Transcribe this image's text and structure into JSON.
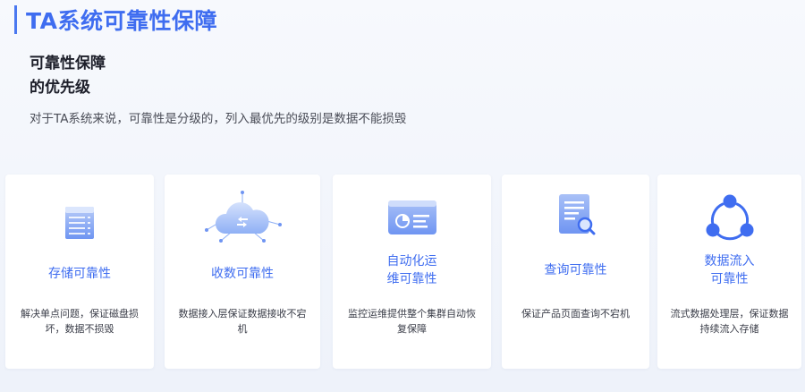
{
  "header": {
    "title": "TA系统可靠性保障"
  },
  "section": {
    "heading_line1": "可靠性保障",
    "heading_line2": "的优先级",
    "description": "对于TA系统来说，可靠性是分级的，列入最优先的级别是数据不能损毁"
  },
  "cards": [
    {
      "icon": "server-storage-icon",
      "title": "存储可靠性",
      "text": "解决单点问题，保证磁盘损坏，数据不损毁"
    },
    {
      "icon": "cloud-network-icon",
      "title": "收数可靠性",
      "text": "数据接入层保证数据接收不宕机"
    },
    {
      "icon": "dashboard-window-icon",
      "title_line1": "自动化运",
      "title_line2": "维可靠性",
      "text": "监控运维提供整个集群自动恢复保障"
    },
    {
      "icon": "document-search-icon",
      "title": "查询可靠性",
      "text": "保证产品页面查询不宕机"
    },
    {
      "icon": "share-nodes-icon",
      "title_line1": "数据流入",
      "title_line2": "可靠性",
      "text": "流式数据处理层，保证数据持续流入存储"
    }
  ],
  "colors": {
    "accent": "#3f6df0",
    "icon_light": "#a9c1f7",
    "icon_mid": "#6f95f2"
  }
}
